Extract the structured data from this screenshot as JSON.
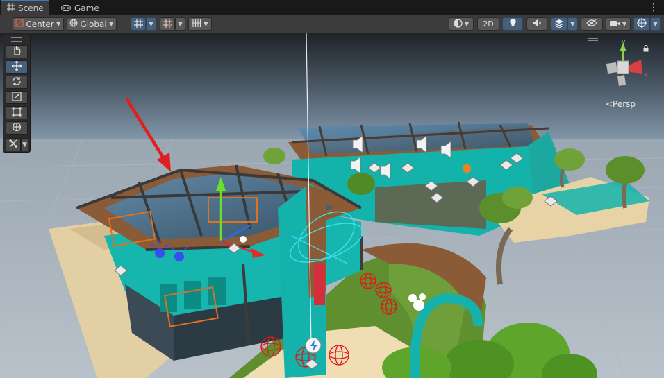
{
  "tabs": [
    {
      "label": "Scene",
      "icon": "scene-grid-icon",
      "active": true
    },
    {
      "label": "Game",
      "icon": "gamepad-icon",
      "active": false
    }
  ],
  "toolbar": {
    "pivot_mode": "Center",
    "pivot_rotation": "Global",
    "view_2d_label": "2D"
  },
  "tools": [
    {
      "name": "hand-tool",
      "icon": "hand-icon"
    },
    {
      "name": "move-tool",
      "icon": "move-arrows-icon",
      "active": true
    },
    {
      "name": "rotate-tool",
      "icon": "rotate-icon"
    },
    {
      "name": "scale-tool",
      "icon": "scale-icon"
    },
    {
      "name": "rect-tool",
      "icon": "rect-icon"
    },
    {
      "name": "transform-tool",
      "icon": "transform-icon"
    },
    {
      "name": "custom-tool",
      "icon": "custom-tools-icon"
    }
  ],
  "orientation_gizmo": {
    "projection_label": "<Persp",
    "axes": [
      "y",
      "x"
    ]
  },
  "colors": {
    "accent": "#3a79bb",
    "sky": "#8aa3b8",
    "ground": "#a3adb6",
    "teal": "#15b8b0",
    "roof_wood": "#8a5b36",
    "annotation_arrow": "#e02020"
  }
}
